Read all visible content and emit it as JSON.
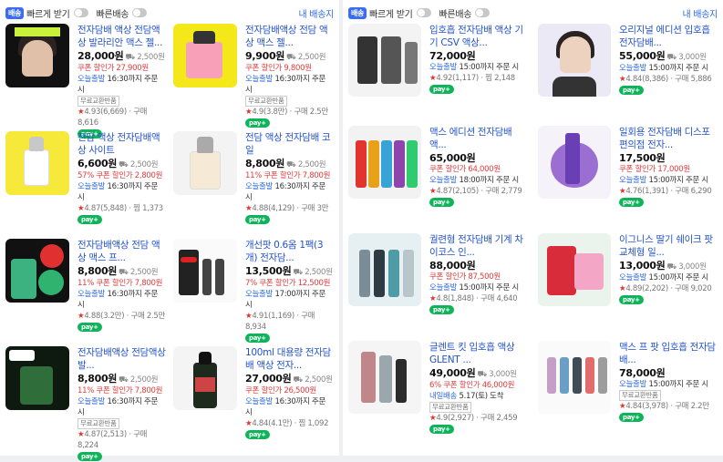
{
  "left": {
    "badge": "배송",
    "fast_label": "빠르게 받기",
    "free_label": "빠른배송",
    "addr_label": "내 배송지",
    "items": [
      {
        "t1": "전자담배 액상 전담액상 발라리안 맥스 젤...",
        "price": "28,000원",
        "ship_fee": "2,500원",
        "coupon": "쿠폰 할인가 27,900원",
        "ship": "오늘출발",
        "ship_tail": "16:30까지 주문 시",
        "tag": "무료교환반품",
        "rating": "4.93",
        "reviews": "(6,669)",
        "buy": "구매 8,616"
      },
      {
        "t1": "전자담배액상 전담 액상 맥스 젤...",
        "price": "9,900원",
        "ship_fee": "2,500원",
        "coupon": "쿠폰 할인가 9,800원",
        "ship": "오늘출발",
        "ship_tail": "16:30까지 주문 시",
        "tag": "무료교환반품",
        "rating": "4.9",
        "reviews": "(3.8만)",
        "buy": "구매 2.5만"
      },
      {
        "t1": "전담 액상 전자담배액상 사이트",
        "price": "6,600원",
        "ship_fee": "2,500원",
        "coupon": "57% 쿠폰 할인가 2,800원",
        "ship": "오늘출발",
        "ship_tail": "16:30까지 주문 시",
        "tag": "",
        "rating": "4.87",
        "reviews": "(5,848)",
        "buy": "찜 1,373"
      },
      {
        "t1": "전담 액상 전자담배 코일",
        "price": "8,800원",
        "ship_fee": "2,500원",
        "coupon": "11% 쿠폰 할인가 7,800원",
        "ship": "오늘출발",
        "ship_tail": "16:30까지 주문 시",
        "tag": "",
        "rating": "4.88",
        "reviews": "(4,129)",
        "buy": "구매 3만"
      },
      {
        "t1": "전자담배액상 전담 액상 맥스 프...",
        "price": "8,800원",
        "ship_fee": "2,500원",
        "coupon": "11% 쿠폰 할인가 7,800원",
        "ship": "오늘출발",
        "ship_tail": "16:30까지 주문 시",
        "tag": "",
        "rating": "4.88",
        "reviews": "(3.2만)",
        "buy": "구매 2.5만"
      },
      {
        "t1": "개선팟 0.6옴 1팩(3개) 전자담...",
        "price": "13,500원",
        "ship_fee": "2,500원",
        "coupon": "7% 쿠폰 할인가 12,500원",
        "ship": "오늘출발",
        "ship_tail": "17:00까지 주문 시",
        "tag": "",
        "rating": "4.91",
        "reviews": "(1,169)",
        "buy": "구매 8,934"
      },
      {
        "t1": "전자담배액상 전담액상 발...",
        "price": "8,800원",
        "ship_fee": "2,500원",
        "coupon": "11% 쿠폰 할인가 7,800원",
        "ship": "오늘출발",
        "ship_tail": "16:30까지 주문 시",
        "tag": "무료교환반품",
        "rating": "4.87",
        "reviews": "(2,513)",
        "buy": "구매 8,224"
      },
      {
        "t1": "100ml 대용량 전자담배 액상 전자...",
        "price": "27,000원",
        "ship_fee": "2,500원",
        "coupon": "쿠폰 할인가 26,500원",
        "ship": "오늘출발",
        "ship_tail": "16:30까지 주문 시",
        "tag": "",
        "rating": "4.84",
        "reviews": "(4.1만)",
        "buy": "찜 1,092"
      }
    ]
  },
  "right": {
    "badge": "배송",
    "fast_label": "빠르게 받기",
    "free_label": "빠른배송",
    "addr_label": "내 배송지",
    "items": [
      {
        "t1": "입호흡 전자담배 액상 기기 CSV 액상...",
        "price": "72,000원",
        "ship_fee": "",
        "coupon": "",
        "ship": "오늘출발",
        "ship_tail": "15:00까지 주문 시",
        "tag": "",
        "rating": "4.92",
        "reviews": "(1,117)",
        "buy": "찜 2,148"
      },
      {
        "t1": "오리지널 에디션 입호흡 전자담배...",
        "price": "55,000원",
        "ship_fee": "3,000원",
        "coupon": "",
        "ship": "오늘출발",
        "ship_tail": "15:00까지 주문 시",
        "tag": "",
        "rating": "4.84",
        "reviews": "(8,386)",
        "buy": "구매 5,886"
      },
      {
        "t1": "맥스 에디션 전자담배 액...",
        "price": "65,000원",
        "ship_fee": "",
        "coupon": "쿠폰 할인가 64,000원",
        "ship": "오늘출발",
        "ship_tail": "18:00까지 주문 시",
        "tag": "",
        "rating": "4.87",
        "reviews": "(2,105)",
        "buy": "구매 2,779"
      },
      {
        "t1": "일회용 전자담배 디스포 편의점 전자...",
        "price": "17,500원",
        "ship_fee": "",
        "coupon": "쿠폰 할인가 17,000원",
        "ship": "오늘출발",
        "ship_tail": "15:00까지 주문 시",
        "tag": "",
        "rating": "4.76",
        "reviews": "(1,391)",
        "buy": "구매 6,290"
      },
      {
        "t1": "궐련형 전자담배 기계 차이코스 인...",
        "price": "88,000원",
        "ship_fee": "",
        "coupon": "쿠폰 할인가 87,500원",
        "ship": "오늘출발",
        "ship_tail": "15:00까지 주문 시",
        "tag": "",
        "rating": "4.8",
        "reviews": "(1,848)",
        "buy": "구매 4,640"
      },
      {
        "t1": "이그니스 딸기 쉐이크 팟 교체형 일...",
        "price": "13,000원",
        "ship_fee": "3,000원",
        "coupon": "",
        "ship": "오늘출발",
        "ship_tail": "15:00까지 주문 시",
        "tag": "",
        "rating": "4.89",
        "reviews": "(2,202)",
        "buy": "구매 9,020"
      },
      {
        "t1": "글렌트 킷 입호흡 액상 GLENT ...",
        "price": "49,000원",
        "ship_fee": "3,000원",
        "coupon": "6% 쿠폰 할인가 46,000원",
        "ship": "내일배송",
        "ship_tail": "5.17(토) 도착",
        "tag": "무료교환반품",
        "rating": "4.9",
        "reviews": "(2,927)",
        "buy": "구매 2,459"
      },
      {
        "t1": "맥스 프 팟 입호흡 전자담배...",
        "price": "78,000원",
        "ship_fee": "",
        "coupon": "",
        "ship": "오늘출발",
        "ship_tail": "15:00까지 주문 시",
        "tag": "무료교환반품",
        "rating": "4.84",
        "reviews": "(3,978)",
        "buy": "구매 2.2만"
      }
    ]
  },
  "npay": "pay+",
  "icons": [
    "toggle-icon",
    "star-icon",
    "truck-icon",
    "npay-icon"
  ]
}
